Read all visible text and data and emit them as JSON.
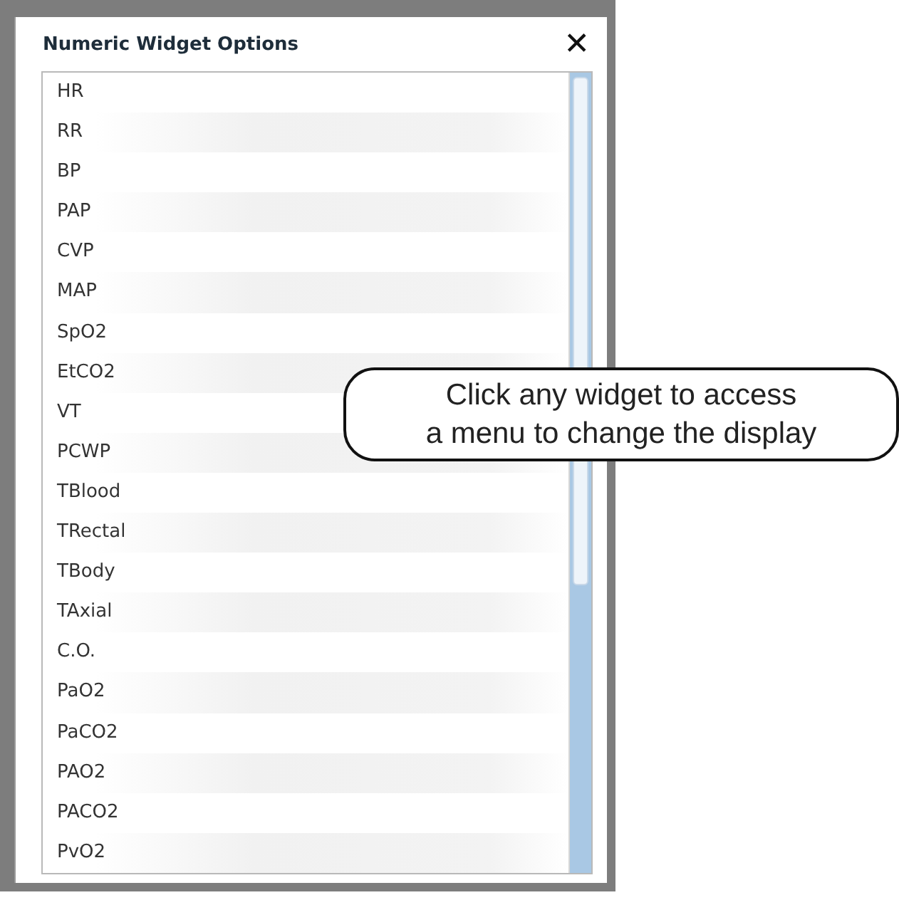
{
  "dialog": {
    "title": "Numeric Widget Options",
    "close": "✕",
    "items": [
      {
        "label": "HR"
      },
      {
        "label": "RR"
      },
      {
        "label": "BP"
      },
      {
        "label": "PAP"
      },
      {
        "label": "CVP"
      },
      {
        "label": "MAP"
      },
      {
        "label": "SpO2"
      },
      {
        "label": "EtCO2"
      },
      {
        "label": "VT"
      },
      {
        "label": "PCWP"
      },
      {
        "label": "TBlood"
      },
      {
        "label": "TRectal"
      },
      {
        "label": "TBody"
      },
      {
        "label": "TAxial"
      },
      {
        "label": "C.O."
      },
      {
        "label": "PaO2"
      },
      {
        "label": "PaCO2"
      },
      {
        "label": "PAO2"
      },
      {
        "label": "PACO2"
      },
      {
        "label": "PvO2"
      }
    ]
  },
  "callout": {
    "lines": [
      "Click any widget to access",
      "a menu to change the display"
    ]
  }
}
